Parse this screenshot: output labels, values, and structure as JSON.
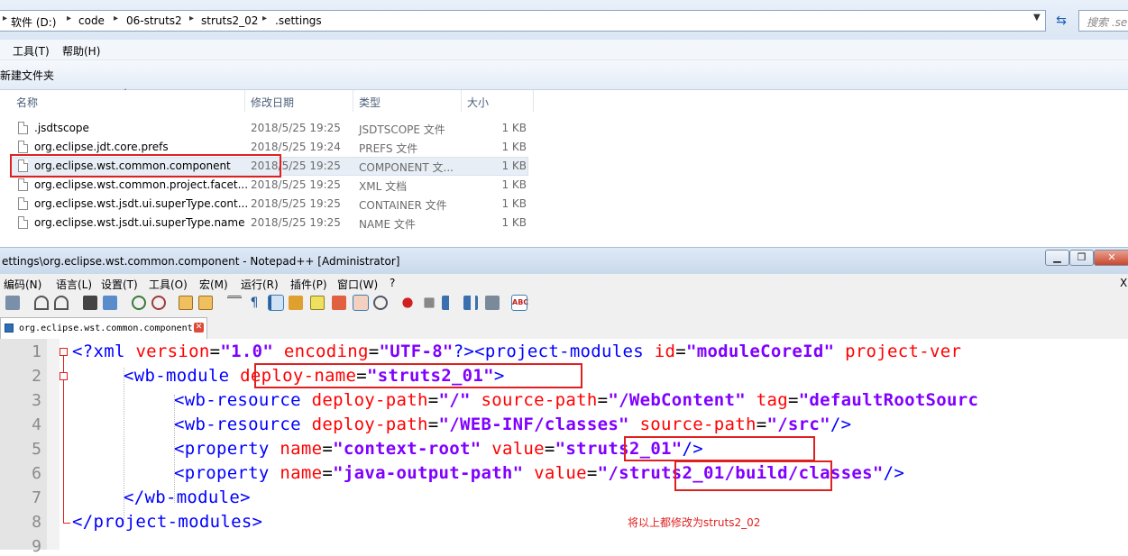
{
  "explorer": {
    "breadcrumb": [
      "软件 (D:)",
      "code",
      "06-struts2",
      "struts2_02",
      ".settings"
    ],
    "search_placeholder": "搜索 .se",
    "menu": [
      "工具(T)",
      "帮助(H)"
    ],
    "new_folder": "新建文件夹",
    "columns": [
      "名称",
      "修改日期",
      "类型",
      "大小"
    ],
    "files": [
      {
        "name": ".jsdtscope",
        "date": "2018/5/25 19:25",
        "type": "JSDTSCOPE 文件",
        "size": "1 KB"
      },
      {
        "name": "org.eclipse.jdt.core.prefs",
        "date": "2018/5/25 19:24",
        "type": "PREFS 文件",
        "size": "1 KB"
      },
      {
        "name": "org.eclipse.wst.common.component",
        "date": "2018/5/25 19:25",
        "type": "COMPONENT 文...",
        "size": "1 KB"
      },
      {
        "name": "org.eclipse.wst.common.project.facet...",
        "date": "2018/5/25 19:25",
        "type": "XML 文档",
        "size": "1 KB"
      },
      {
        "name": "org.eclipse.wst.jsdt.ui.superType.cont...",
        "date": "2018/5/25 19:25",
        "type": "CONTAINER 文件",
        "size": "1 KB"
      },
      {
        "name": "org.eclipse.wst.jsdt.ui.superType.name",
        "date": "2018/5/25 19:25",
        "type": "NAME 文件",
        "size": "1 KB"
      }
    ]
  },
  "notepad": {
    "title": "ettings\\org.eclipse.wst.common.component - Notepad++ [Administrator]",
    "menu": [
      "编码(N)",
      "语言(L)",
      "设置(T)",
      "工具(O)",
      "宏(M)",
      "运行(R)",
      "插件(P)",
      "窗口(W)",
      "?"
    ],
    "close_x": "X",
    "tab": "org.eclipse.wst.common.component",
    "line_numbers": [
      "1",
      "2",
      "3",
      "4",
      "5",
      "6",
      "7",
      "8",
      "9"
    ],
    "code": {
      "l1": [
        "<?xml ",
        "version",
        "=",
        "\"1.0\"",
        " ",
        "encoding",
        "=",
        "\"UTF-8\"",
        "?><project-modules ",
        "id",
        "=",
        "\"moduleCoreId\"",
        " ",
        "project-ver"
      ],
      "l2": [
        "<wb-module ",
        "deploy-name",
        "=",
        "\"struts2_01\"",
        ">"
      ],
      "l3": [
        "<wb-resource ",
        "deploy-path",
        "=",
        "\"/\"",
        " ",
        "source-path",
        "=",
        "\"/WebContent\"",
        " ",
        "tag",
        "=",
        "\"defaultRootSourc"
      ],
      "l4": [
        "<wb-resource ",
        "deploy-path",
        "=",
        "\"/WEB-INF/classes\"",
        " ",
        "source-path",
        "=",
        "\"/src\"",
        "/>"
      ],
      "l5": [
        "<property ",
        "name",
        "=",
        "\"context-root\"",
        " ",
        "value",
        "=",
        "\"struts2_01\"",
        "/>"
      ],
      "l6": [
        "<property ",
        "name",
        "=",
        "\"java-output-path\"",
        " ",
        "value",
        "=",
        "\"/struts2_01/build/classes\"",
        "/>"
      ],
      "l7": [
        "</wb-module>"
      ],
      "l8": [
        "</project-modules>"
      ]
    },
    "note": "将以上都修改为struts2_02"
  }
}
